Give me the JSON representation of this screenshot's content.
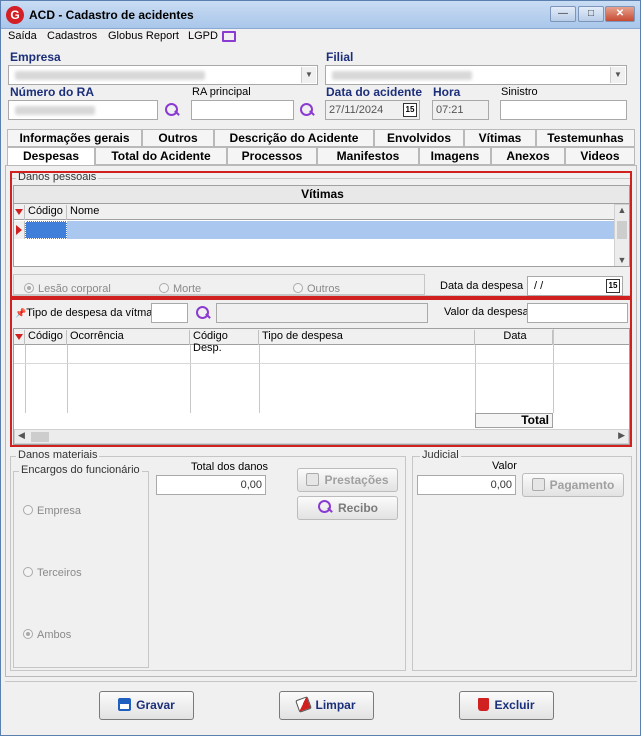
{
  "window": {
    "title": "ACD - Cadastro de acidentes",
    "app_icon": "G"
  },
  "menu": [
    "Saída",
    "Cadastros",
    "Globus Report",
    "LGPD"
  ],
  "header": {
    "empresa_label": "Empresa",
    "filial_label": "Filial",
    "numero_ra_label": "Número do RA",
    "ra_principal_label": "RA principal",
    "data_acidente_label": "Data do acidente",
    "data_acidente_value": "27/11/2024",
    "hora_label": "Hora",
    "hora_value": "07:21",
    "sinistro_label": "Sinistro",
    "calendar_day": "15"
  },
  "tabs_row1": [
    "Informações gerais",
    "Outros",
    "Descrição do Acidente",
    "Envolvidos",
    "Vítimas",
    "Testemunhas"
  ],
  "tabs_row2": [
    "Despesas",
    "Total do Acidente",
    "Processos",
    "Manifestos",
    "Imagens",
    "Anexos",
    "Videos"
  ],
  "danos_pessoais": {
    "label": "Danos pessoais",
    "grid_title": "Vítimas",
    "columns": [
      "Código",
      "Nome"
    ],
    "radios": [
      "Lesão corporal",
      "Morte",
      "Outros"
    ],
    "data_despesa_label": "Data da despesa",
    "data_despesa_value": " /  /"
  },
  "despesas": {
    "tipo_label": "Tipo de despesa da vítma.",
    "valor_label": "Valor da despesa",
    "columns": [
      "Código",
      "Ocorrência",
      "Código Desp.",
      "Tipo de despesa",
      "Data"
    ],
    "total_label": "Total"
  },
  "danos_materiais": {
    "label": "Danos materiais",
    "encargos_label": "Encargos do funcionário",
    "radios": [
      "Empresa",
      "Terceiros",
      "Ambos"
    ],
    "total_label": "Total dos danos",
    "total_value": "0,00",
    "prestacoes_label": "Prestações",
    "recibo_label": "Recibo"
  },
  "judicial": {
    "label": "Judicial",
    "valor_label": "Valor",
    "valor_value": "0,00",
    "pagamento_label": "Pagamento"
  },
  "footer": {
    "gravar": "Gravar",
    "limpar": "Limpar",
    "excluir": "Excluir"
  }
}
